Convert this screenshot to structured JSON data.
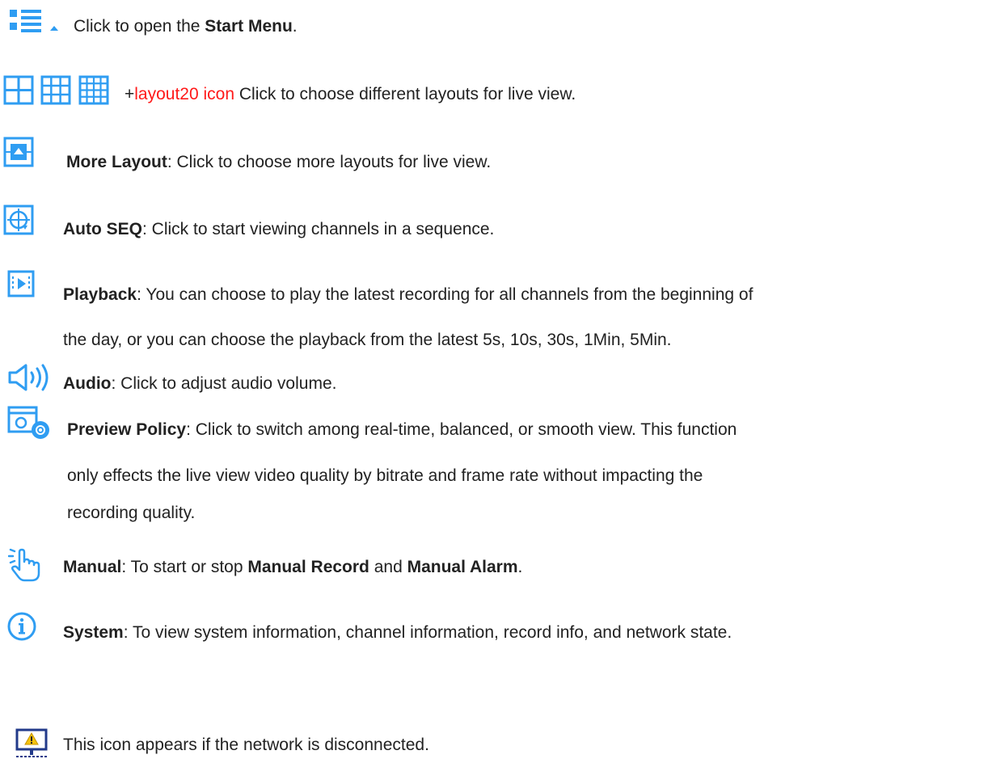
{
  "colors": {
    "icon_blue": "#2f9df2",
    "highlight_red": "#ff1a1a",
    "text": "#222222"
  },
  "items": [
    {
      "icon": "start-menu-icon",
      "pre": "Click to open the ",
      "bold": "Start Menu",
      "post": "."
    },
    {
      "icons": [
        "layout-4-icon",
        "layout-9-icon",
        "layout-16-icon"
      ],
      "plus": "+",
      "red": "layout20 icon",
      "post": " Click to choose different layouts for live view."
    },
    {
      "icon": "more-layout-icon",
      "bold": "More Layout",
      "post": ": Click to choose more layouts for live view."
    },
    {
      "icon": "auto-seq-icon",
      "bold": "Auto SEQ",
      "post": ": Click to start viewing channels in a sequence."
    },
    {
      "icon": "playback-icon",
      "bold": "Playback",
      "post": ": You can choose to play the latest recording for all channels from the beginning of",
      "line2": "the day, or you can choose the playback from the latest 5s, 10s, 30s, 1Min, 5Min."
    },
    {
      "icon": "audio-icon",
      "bold": "Audio",
      "post": ": Click to adjust audio volume."
    },
    {
      "icon": "preview-policy-icon",
      "bold": "Preview Policy",
      "post": ": Click to switch among real-time, balanced, or smooth view. This function",
      "line2": "only effects the live view video quality by bitrate and frame rate without impacting the",
      "line3": "recording quality."
    },
    {
      "icon": "manual-icon",
      "bold": "Manual",
      "mid": ": To start or stop ",
      "bold2": "Manual Record",
      "mid2": " and ",
      "bold3": "Manual Alarm",
      "post": "."
    },
    {
      "icon": "system-info-icon",
      "bold": "System",
      "post": ": To view system information, channel information, record info, and network state."
    },
    {
      "icon": "network-disconnected-icon",
      "post": "This icon appears if the network is disconnected."
    }
  ]
}
